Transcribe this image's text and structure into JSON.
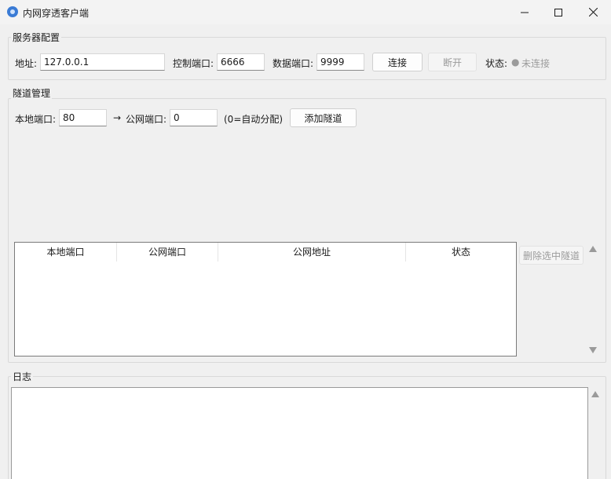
{
  "window": {
    "title": "内网穿透客户端"
  },
  "server": {
    "group_title": "服务器配置",
    "address_label": "地址:",
    "address_value": "127.0.0.1",
    "control_port_label": "控制端口:",
    "control_port_value": "6666",
    "data_port_label": "数据端口:",
    "data_port_value": "9999",
    "connect_label": "连接",
    "disconnect_label": "断开",
    "status_label": "状态:",
    "status_dot": "●",
    "status_value": "未连接"
  },
  "tunnel": {
    "group_title": "隧道管理",
    "local_port_label": "本地端口:",
    "local_port_value": "80",
    "arrow": "→",
    "public_port_label": "公网端口:",
    "public_port_value": "0",
    "auto_hint": "(0=自动分配)",
    "add_label": "添加隧道",
    "delete_label": "删除选中隧道",
    "columns": [
      "本地端口",
      "公网端口",
      "公网地址",
      "状态"
    ]
  },
  "log": {
    "group_title": "日志"
  },
  "colors": {
    "status_gray": "#9b9b9b",
    "app_icon_blue": "#3a7bd5"
  }
}
